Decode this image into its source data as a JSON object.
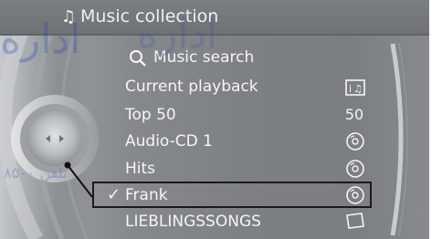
{
  "header": {
    "title": "Music collection",
    "icon": "music-note-icon"
  },
  "menu": [
    {
      "label": "Music search",
      "icon": "search-icon",
      "value": "",
      "value_icon": ""
    },
    {
      "label": "Current playback",
      "icon": "",
      "value": "",
      "value_icon": "info-music-icon"
    },
    {
      "label": "Top 50",
      "icon": "",
      "value": "50",
      "value_icon": ""
    },
    {
      "label": "Audio-CD 1",
      "icon": "",
      "value": "",
      "value_icon": "cd-icon"
    },
    {
      "label": "Hits",
      "icon": "",
      "value": "",
      "value_icon": "cd-icon"
    },
    {
      "label": "Frank",
      "icon": "",
      "value": "",
      "value_icon": "cd-icon",
      "selected": true,
      "checked": true
    },
    {
      "label": "LIEBLINGSSONGS",
      "icon": "",
      "value": "",
      "value_icon": "folder-icon"
    }
  ],
  "watermark": {
    "line1": "اداره",
    "line2": "تلفن ۸۵۰۰"
  },
  "colors": {
    "text": "#f4f5f6",
    "highlight_border": "#1a1a1a",
    "title_bar": "#74787b"
  }
}
